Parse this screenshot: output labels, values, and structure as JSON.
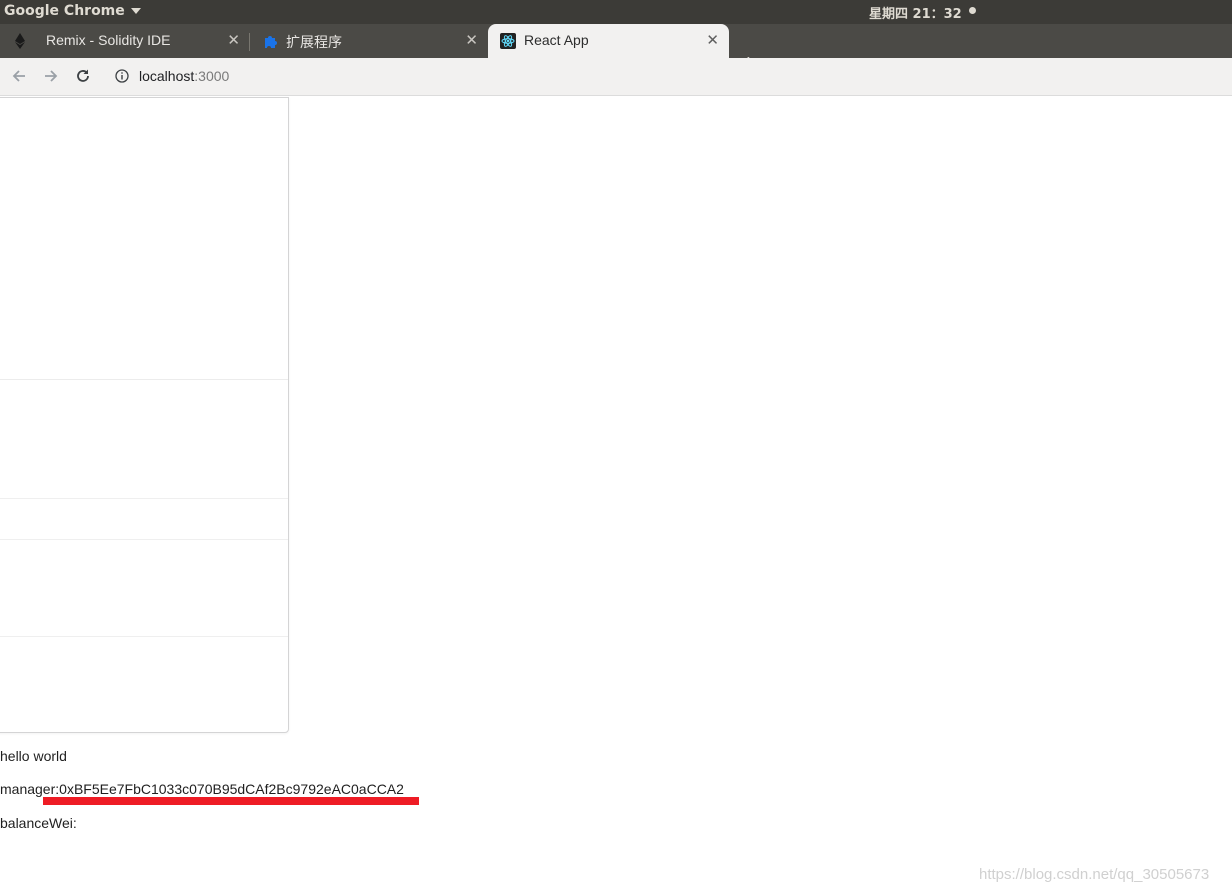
{
  "system_bar": {
    "app_name": "Google Chrome",
    "clock": "星期四 21：32"
  },
  "tabs": [
    {
      "title": "Remix - Solidity IDE",
      "icon": "ethereum-icon",
      "active": false
    },
    {
      "title": "扩展程序",
      "icon": "puzzle-icon",
      "active": false
    },
    {
      "title": "React App",
      "icon": "react-icon",
      "active": true
    }
  ],
  "address_bar": {
    "host": "localhost",
    "port": ":3000"
  },
  "page": {
    "hello": "hello world",
    "manager_label": "manager:",
    "manager_value": "0xBF5Ee7FbC1033c070B95dCAf2Bc9792eAC0aCCA2",
    "balance_label": "balanceWei:",
    "balance_value": ""
  },
  "watermark": "https://blog.csdn.net/qq_30505673",
  "colors": {
    "underline": "#ee1c25",
    "tab_strip": "#4b4a46",
    "top_bar": "#3c3b37"
  }
}
